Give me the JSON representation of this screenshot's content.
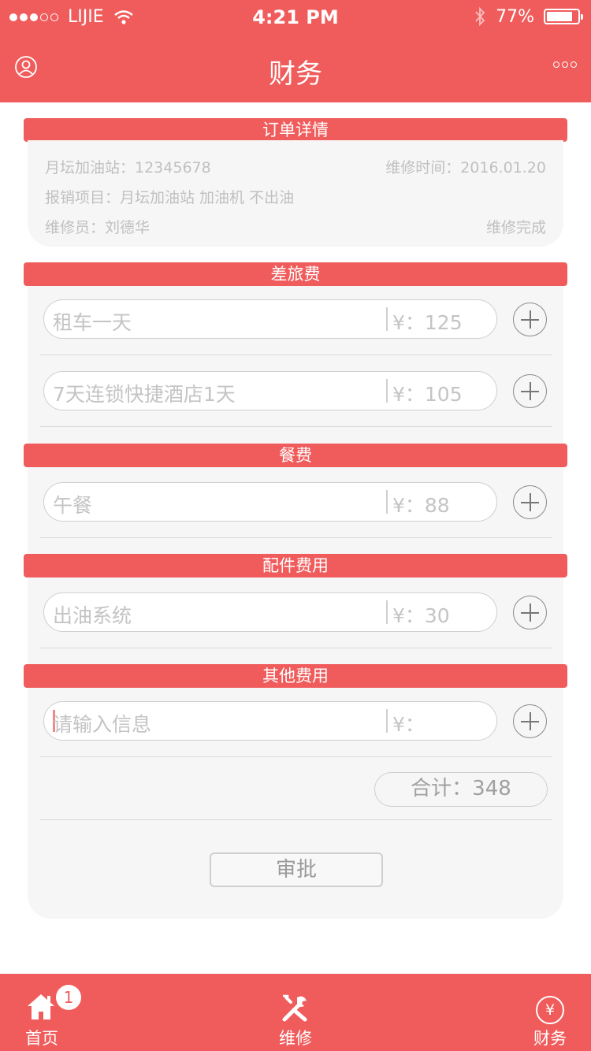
{
  "status": {
    "carrier": "LIJIE",
    "time": "4:21 PM",
    "battery": "77%",
    "battery_level": 0.77,
    "signal_bars": 3,
    "signal_total": 5
  },
  "nav": {
    "title": "财务",
    "left_icon": "user-icon",
    "right_icon": "more-icon"
  },
  "order": {
    "header": "订单详情",
    "station": "月坛加油站：12345678",
    "repair_time": "维修时间：2016.01.20",
    "project": "报销项目：月坛加油站 加油机 不出油",
    "technician": "维修员：刘德华",
    "status": "维修完成"
  },
  "sections": {
    "travel": {
      "title": "差旅费",
      "items": [
        {
          "desc": "租车一天",
          "amount": "¥：125"
        },
        {
          "desc": "7天连锁快捷酒店1天",
          "amount": "¥：105"
        }
      ]
    },
    "meal": {
      "title": "餐费",
      "items": [
        {
          "desc": "午餐",
          "amount": "¥：88"
        }
      ]
    },
    "parts": {
      "title": "配件费用",
      "items": [
        {
          "desc": "出油系统",
          "amount": "¥：30"
        }
      ]
    },
    "other": {
      "title": "其他费用",
      "input_placeholder": "请输入信息",
      "amount_placeholder": "¥："
    }
  },
  "total": "合计：348",
  "approve_label": "审批",
  "tabbar": {
    "home": {
      "label": "首页",
      "badge": "1",
      "icon": "home-icon"
    },
    "repair": {
      "label": "维修",
      "icon": "tools-icon"
    },
    "finance": {
      "label": "财务",
      "icon": "yen-icon",
      "glyph": "¥"
    }
  },
  "colors": {
    "accent": "#f05c5c",
    "panel": "#f6f6f6",
    "muted_text": "#c4c4c4"
  }
}
